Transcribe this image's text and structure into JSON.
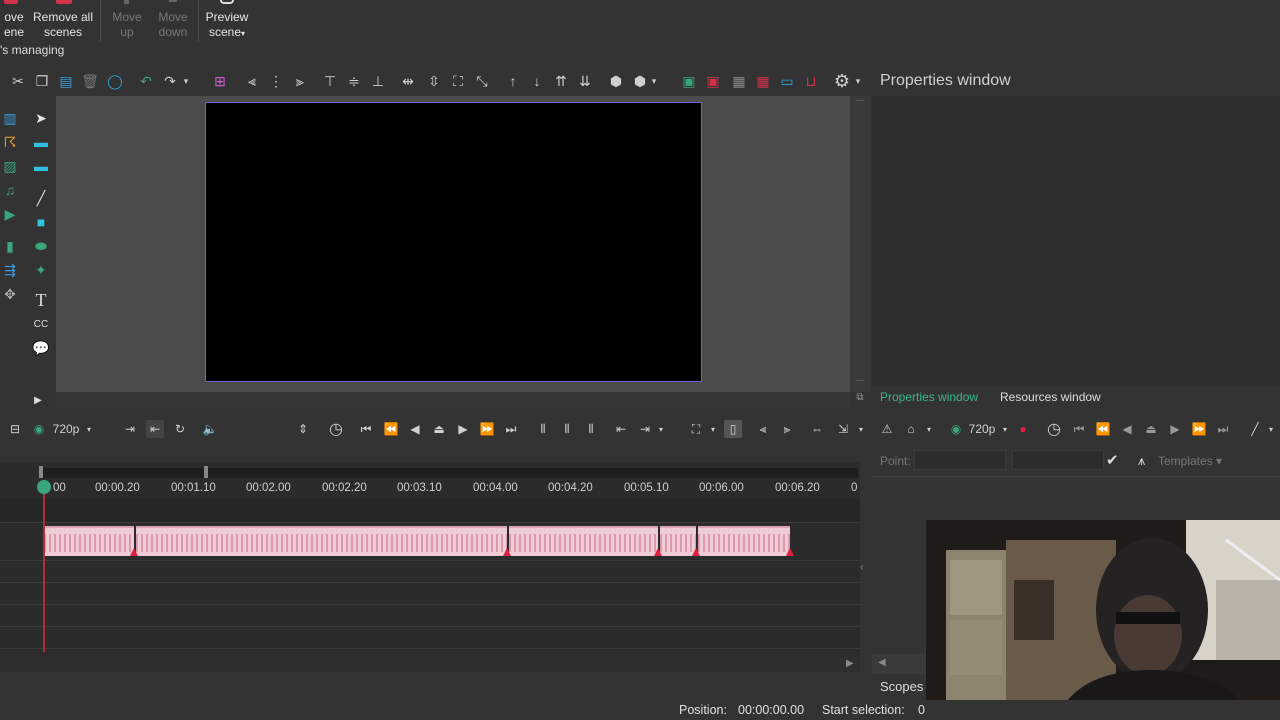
{
  "ribbon": {
    "remove_scene_l1": "ove",
    "remove_scene_l2": "ene",
    "remove_all_l1": "Remove all",
    "remove_all_l2": "scenes",
    "move_up_l1": "Move",
    "move_up_l2": "up",
    "move_down_l1": "Move",
    "move_down_l2": "down",
    "preview_l1": "Preview",
    "preview_l2": "scene",
    "group_label": "'s managing"
  },
  "canvas": {
    "resolution": "720p"
  },
  "properties": {
    "title": "Properties window",
    "tab_properties": "Properties window",
    "tab_resources": "Resources window",
    "point_label": "Point:",
    "templates_label": "Templates",
    "resolution": "720p"
  },
  "timeline": {
    "ticks": [
      "00",
      "00:00.20",
      "00:01.10",
      "00:02.00",
      "00:02.20",
      "00:03.10",
      "00:04.00",
      "00:04.20",
      "00:05.10",
      "00:06.00",
      "00:06.20",
      "0"
    ]
  },
  "status": {
    "position_label": "Position:",
    "position_value": "00:00:00.00",
    "start_selection_label": "Start selection:",
    "start_selection_value": "0"
  },
  "scopes": {
    "label": "Scopes"
  },
  "colors": {
    "accent_green": "#3aa57a",
    "record_red": "#e02040",
    "scene_border": "#6f62c8"
  }
}
